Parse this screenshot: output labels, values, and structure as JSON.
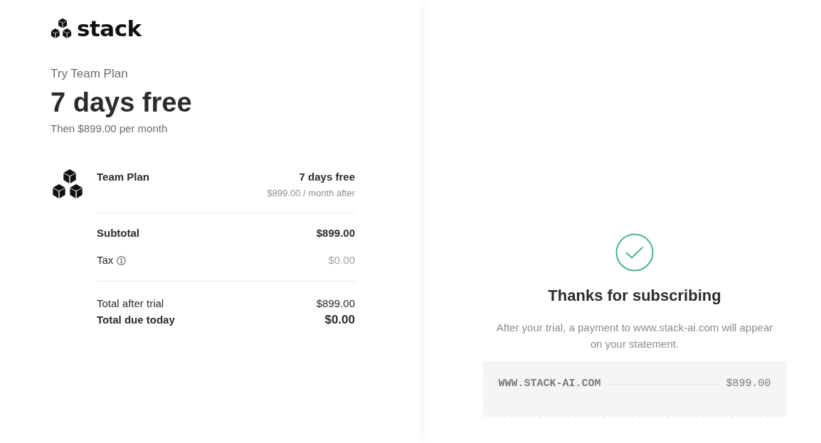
{
  "brand": {
    "name": "stack"
  },
  "summary": {
    "eyebrow": "Try Team Plan",
    "headline": "7 days free",
    "subline": "Then $899.00 per month"
  },
  "line_items": [
    {
      "name": "Team Plan",
      "price": "7 days free",
      "note": "$899.00 / month after"
    }
  ],
  "totals": [
    {
      "kind": "subtotal",
      "label": "Subtotal",
      "amount": "$899.00"
    },
    {
      "kind": "tax",
      "label": "Tax",
      "amount": "$0.00"
    }
  ],
  "final": [
    {
      "kind": "after_trial",
      "label": "Total after trial",
      "amount": "$899.00"
    },
    {
      "kind": "due",
      "label": "Total due today",
      "amount": "$0.00"
    }
  ],
  "confirmation": {
    "title": "Thanks for subscribing",
    "message": "After your trial, a payment to www.stack-ai.com will appear on your statement.",
    "receipt": {
      "descriptor": "WWW.STACK-AI.COM",
      "amount": "$899.00"
    }
  }
}
